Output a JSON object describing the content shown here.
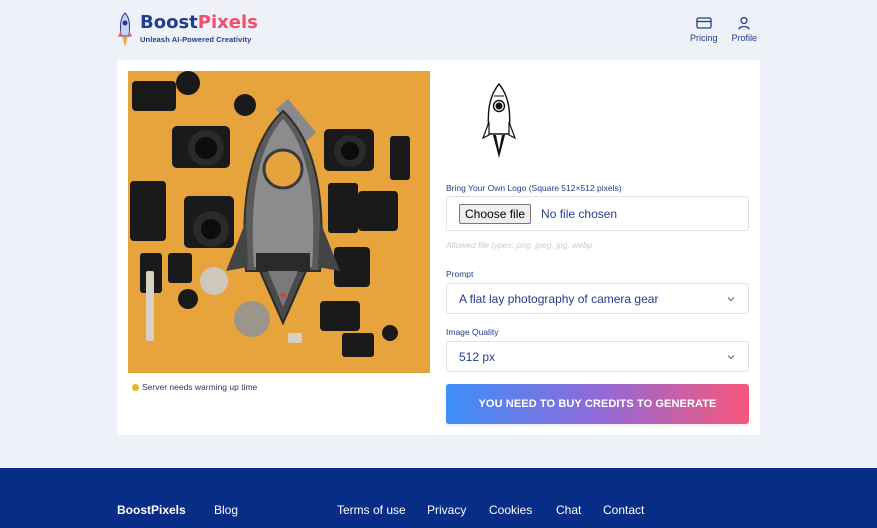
{
  "header": {
    "brand_part1": "Boost",
    "brand_part2": "Pixels",
    "tagline": "Unleash AI-Powered Creativity",
    "nav": [
      {
        "label": "Pricing",
        "icon": "credit-card-icon"
      },
      {
        "label": "Profile",
        "icon": "user-icon"
      }
    ]
  },
  "preview": {
    "status_text": "Server needs warming up time",
    "status_color": "#e8b52a"
  },
  "form": {
    "logo_label": "Bring Your Own Logo (Square 512×512 pixels)",
    "file_button": "Choose file",
    "file_status": "No file chosen",
    "allowed_types": "Allowed file types: png, jpeg, jpg, webp",
    "prompt_label": "Prompt",
    "prompt_value": "A flat lay photography of camera gear",
    "quality_label": "Image Quality",
    "quality_value": "512 px",
    "generate_label": "YOU NEED TO BUY CREDITS TO GENERATE"
  },
  "footer": {
    "brand": "BoostPixels",
    "links": [
      "Blog",
      "Terms of use",
      "Privacy",
      "Cookies",
      "Chat",
      "Contact"
    ]
  },
  "colors": {
    "brand_blue": "#243c8f",
    "brand_pink": "#f0506e",
    "footer_bg": "#072d86",
    "gradient_start": "#3c8ef8",
    "gradient_end": "#f7577a"
  }
}
